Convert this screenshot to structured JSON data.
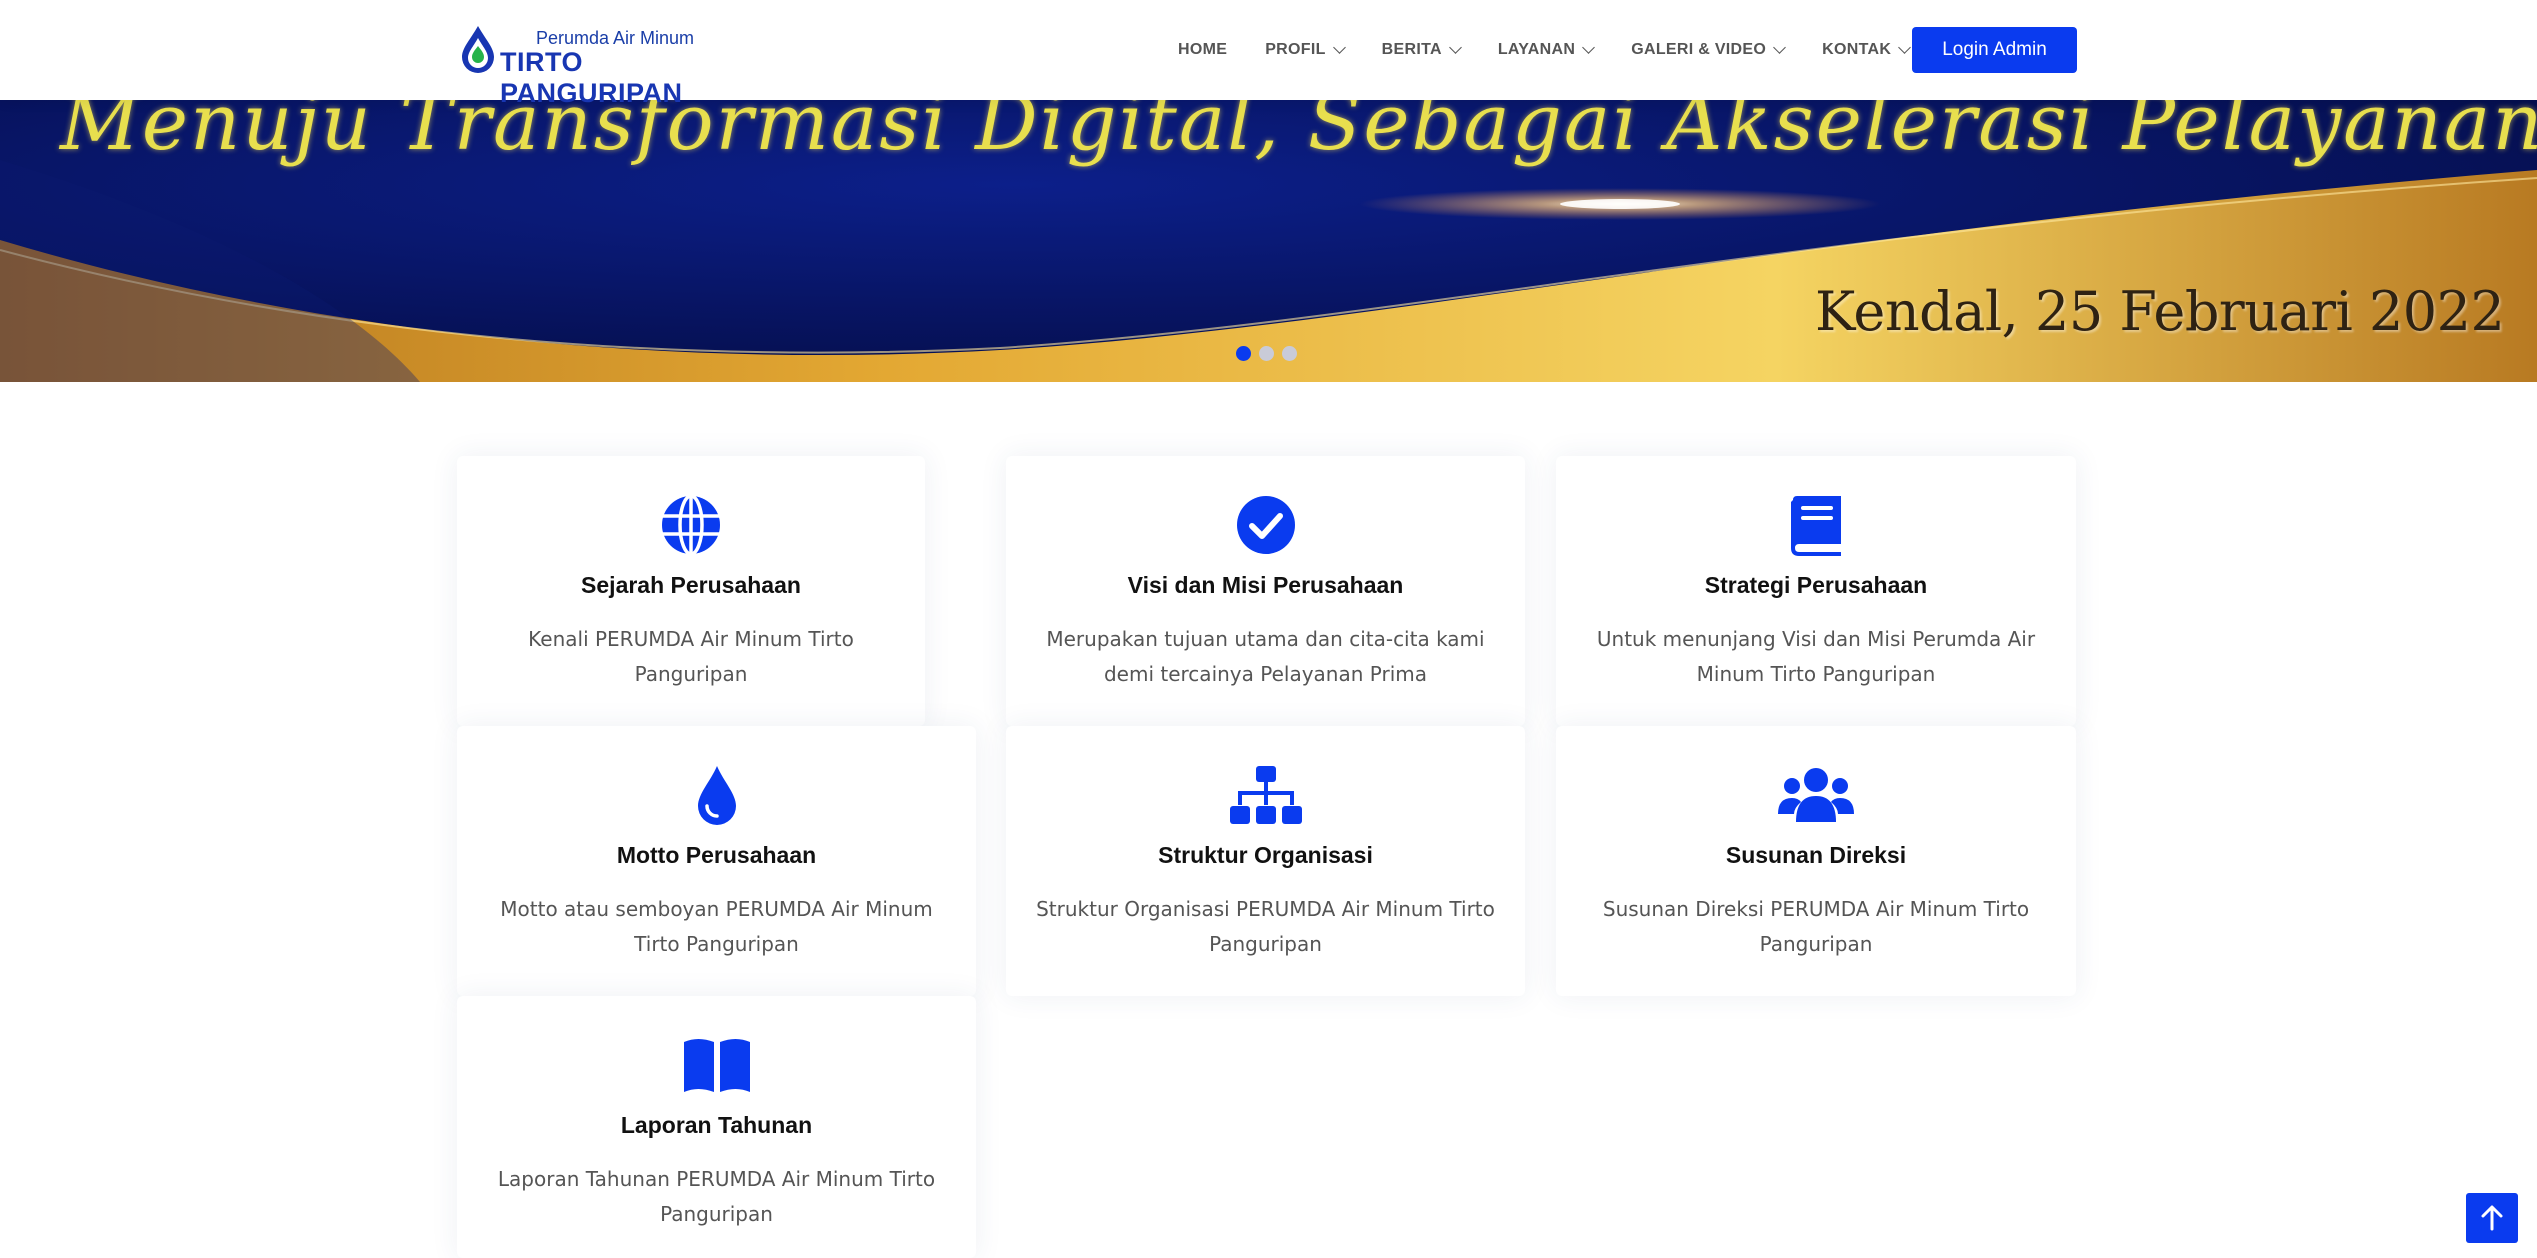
{
  "header": {
    "logo_top": "Perumda Air Minum",
    "logo_bottom": "TIRTO PANGURIPAN",
    "nav": [
      {
        "label": "HOME",
        "dropdown": false
      },
      {
        "label": "PROFIL",
        "dropdown": true
      },
      {
        "label": "BERITA",
        "dropdown": true
      },
      {
        "label": "LAYANAN",
        "dropdown": true
      },
      {
        "label": "GALERI & VIDEO",
        "dropdown": true
      },
      {
        "label": "KONTAK",
        "dropdown": true
      }
    ],
    "login_label": "Login Admin"
  },
  "banner": {
    "headline": "Menuju Transformasi Digital, Sebagai Akselerasi Pelayanan Prima",
    "date": "Kendal, 25 Februari 2022",
    "slides": 3,
    "active_slide": 1
  },
  "cards": [
    {
      "icon": "globe-icon",
      "title": "Sejarah Perusahaan",
      "desc": "Kenali PERUMDA Air Minum Tirto Panguripan"
    },
    {
      "icon": "check-circle-icon",
      "title": "Visi dan Misi Perusahaan",
      "desc": "Merupakan tujuan utama dan cita-cita kami demi tercainya Pelayanan Prima"
    },
    {
      "icon": "book-icon",
      "title": "Strategi Perusahaan",
      "desc": "Untuk menunjang Visi dan Misi Perumda Air Minum Tirto Panguripan"
    },
    {
      "icon": "water-drop-icon",
      "title": "Motto Perusahaan",
      "desc": "Motto atau semboyan PERUMDA Air Minum Tirto Panguripan"
    },
    {
      "icon": "sitemap-icon",
      "title": "Struktur Organisasi",
      "desc": "Struktur Organisasi PERUMDA Air Minum Tirto Panguripan"
    },
    {
      "icon": "users-icon",
      "title": "Susunan Direksi",
      "desc": "Susunan Direksi PERUMDA Air Minum Tirto Panguripan"
    },
    {
      "icon": "open-book-icon",
      "title": "Laporan Tahunan",
      "desc": "Laporan Tahunan PERUMDA Air Minum Tirto Panguripan"
    }
  ],
  "colors": {
    "accent": "#0a3bef",
    "text": "#111111",
    "muted": "#555555"
  },
  "scroll_top_icon": "arrow-up-icon"
}
